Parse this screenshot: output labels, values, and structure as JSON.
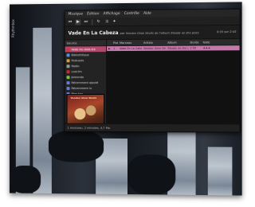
{
  "desktop": {
    "side_label": "Rhythmbox"
  },
  "menu": [
    "Musique",
    "Édition",
    "Affichage",
    "Contrôle",
    "Aide"
  ],
  "toolbar": {
    "icons": [
      "previous-icon",
      "play-icon",
      "next-icon",
      "repeat-icon",
      "shuffle-icon",
      "visualizer-icon"
    ]
  },
  "now_playing": {
    "title": "Vade En La Cabeza",
    "subtitle": "par Voodoo Glow Skulls de l'album Steady as she goes",
    "time": "0:35 sur 2:45"
  },
  "sidebar": {
    "header": "Source",
    "items": [
      {
        "label": "Vade Inc-Aide-Ed",
        "color": "#cc3344",
        "selected": true
      },
      {
        "label": "Bibliothèque",
        "color": "#5a8fd0"
      },
      {
        "label": "Podcasts",
        "color": "#d0a040"
      },
      {
        "label": "Radio",
        "color": "#9a9a9a"
      },
      {
        "label": "Last.fm",
        "color": "#c0302a"
      },
      {
        "label": "Jamendo",
        "color": "#7fbf50"
      },
      {
        "label": "Récemment ajouté",
        "color": "#6a7bd0"
      },
      {
        "label": "Récemment lu",
        "color": "#6a7bd0"
      },
      {
        "label": "Mon top",
        "color": "#6a7bd0"
      }
    ],
    "cover_text": "Voodoo Glow Skulls"
  },
  "table": {
    "columns": [
      "",
      "Piste",
      "Morceau",
      "Artiste",
      "Album",
      "Durée",
      "Note"
    ],
    "rows": [
      [
        "▶",
        "1",
        "Vade En La Cabeza",
        "Voodoo Glow Skulls",
        "Steady as she goes",
        "2:45",
        "★★★"
      ]
    ]
  },
  "status": "1 morceau, 2 minutes, 4,7 Mo"
}
